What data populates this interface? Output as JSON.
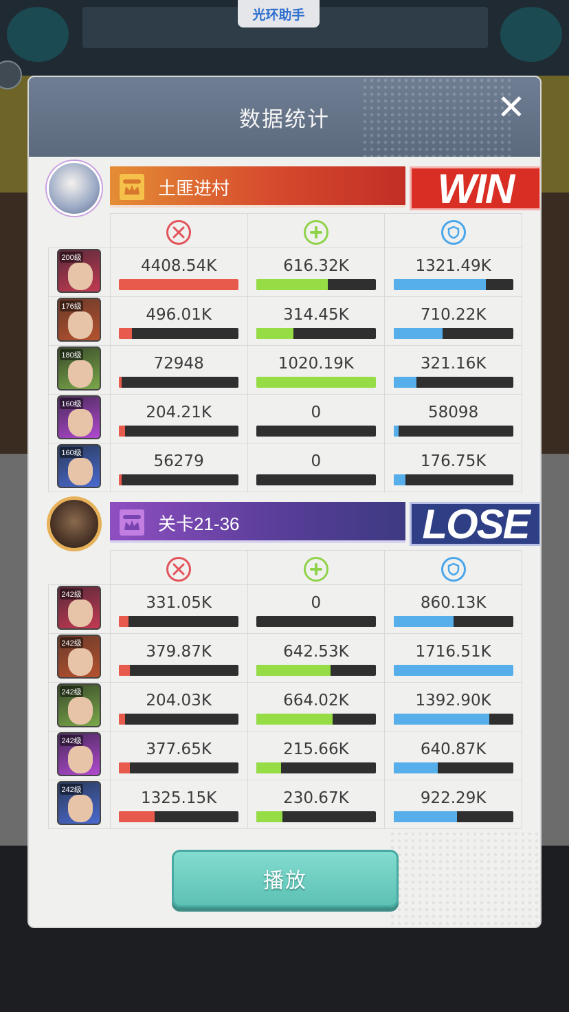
{
  "helper_tab": "光环助手",
  "modal": {
    "title": "数据统计",
    "close_label": "✕",
    "play_button": "播放"
  },
  "colors": {
    "damage": "#e85a4c",
    "heal": "#95dc45",
    "tank": "#56aeea",
    "win_red": "#d82e24",
    "lose_blue": "#2f3f86"
  },
  "columns": [
    {
      "icon": "sword-crossed-icon",
      "stat": "damage"
    },
    {
      "icon": "heal-plus-icon",
      "stat": "heal"
    },
    {
      "icon": "shield-icon",
      "stat": "damage-taken"
    }
  ],
  "teams": [
    {
      "name": "土匪进村",
      "result": "WIN",
      "heroes": [
        {
          "level": "200级",
          "damage": "4408.54K",
          "damage_pct": 100,
          "heal": "616.32K",
          "heal_pct": 60,
          "tank": "1321.49K",
          "tank_pct": 77
        },
        {
          "level": "176级",
          "damage": "496.01K",
          "damage_pct": 11,
          "heal": "314.45K",
          "heal_pct": 31,
          "tank": "710.22K",
          "tank_pct": 41
        },
        {
          "level": "180级",
          "damage": "72948",
          "damage_pct": 2,
          "heal": "1020.19K",
          "heal_pct": 100,
          "tank": "321.16K",
          "tank_pct": 19
        },
        {
          "level": "160级",
          "damage": "204.21K",
          "damage_pct": 5,
          "heal": "0",
          "heal_pct": 0,
          "tank": "58098",
          "tank_pct": 4
        },
        {
          "level": "160级",
          "damage": "56279",
          "damage_pct": 1,
          "heal": "0",
          "heal_pct": 0,
          "tank": "176.75K",
          "tank_pct": 10
        }
      ]
    },
    {
      "name": "关卡21-36",
      "result": "LOSE",
      "heroes": [
        {
          "level": "242级",
          "damage": "331.05K",
          "damage_pct": 8,
          "heal": "0",
          "heal_pct": 0,
          "tank": "860.13K",
          "tank_pct": 50
        },
        {
          "level": "242级",
          "damage": "379.87K",
          "damage_pct": 9,
          "heal": "642.53K",
          "heal_pct": 62,
          "tank": "1716.51K",
          "tank_pct": 100
        },
        {
          "level": "242级",
          "damage": "204.03K",
          "damage_pct": 5,
          "heal": "664.02K",
          "heal_pct": 64,
          "tank": "1392.90K",
          "tank_pct": 80
        },
        {
          "level": "242级",
          "damage": "377.65K",
          "damage_pct": 9,
          "heal": "215.66K",
          "heal_pct": 21,
          "tank": "640.87K",
          "tank_pct": 37
        },
        {
          "level": "242级",
          "damage": "1325.15K",
          "damage_pct": 30,
          "heal": "230.67K",
          "heal_pct": 22,
          "tank": "922.29K",
          "tank_pct": 53
        }
      ]
    }
  ]
}
